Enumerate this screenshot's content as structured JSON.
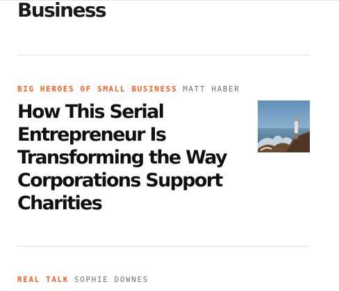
{
  "previous_story": {
    "title": "Business"
  },
  "featured_story": {
    "category": "BIG HEROES OF SMALL BUSINESS",
    "author": "MATT HABER",
    "headline": "How This Serial Entrepreneur Is Transforming the Way Corporations Support Charities",
    "thumbnail": "man-standing-on-seaside-rocks-photo"
  },
  "next_story": {
    "category": "REAL TALK",
    "author": "SOPHIE DOWNES"
  },
  "colors": {
    "category_accent": "#ff5a1f",
    "author_gray": "#707070",
    "headline": "#111111",
    "divider": "#e3e3e3"
  }
}
